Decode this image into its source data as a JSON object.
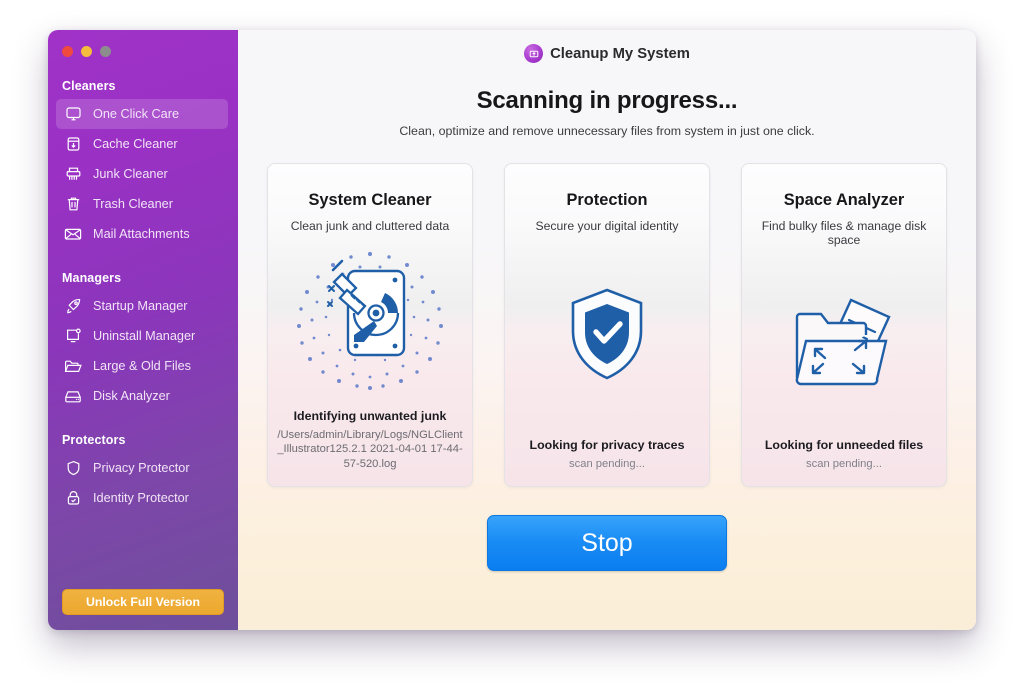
{
  "window": {
    "traffic_lights": [
      "close",
      "minimize",
      "zoom"
    ]
  },
  "sidebar": {
    "sections": [
      {
        "title": "Cleaners",
        "items": [
          {
            "label": "One Click Care",
            "icon": "monitor-icon",
            "active": true
          },
          {
            "label": "Cache Cleaner",
            "icon": "box-download-icon",
            "active": false
          },
          {
            "label": "Junk Cleaner",
            "icon": "shredder-icon",
            "active": false
          },
          {
            "label": "Trash Cleaner",
            "icon": "trash-icon",
            "active": false
          },
          {
            "label": "Mail Attachments",
            "icon": "envelope-icon",
            "active": false
          }
        ]
      },
      {
        "title": "Managers",
        "items": [
          {
            "label": "Startup Manager",
            "icon": "rocket-icon",
            "active": false
          },
          {
            "label": "Uninstall Manager",
            "icon": "monitor-gear-icon",
            "active": false
          },
          {
            "label": "Large & Old Files",
            "icon": "open-folder-icon",
            "active": false
          },
          {
            "label": "Disk Analyzer",
            "icon": "disk-drive-icon",
            "active": false
          }
        ]
      },
      {
        "title": "Protectors",
        "items": [
          {
            "label": "Privacy Protector",
            "icon": "shield-icon",
            "active": false
          },
          {
            "label": "Identity Protector",
            "icon": "lock-check-icon",
            "active": false
          }
        ]
      }
    ],
    "unlock_button": "Unlock Full Version"
  },
  "header": {
    "app_name": "Cleanup My System",
    "logo_icon": "cleanup-logo-icon",
    "headline": "Scanning in progress...",
    "subhead": "Clean, optimize and remove unnecessary files from system in just one click."
  },
  "cards": [
    {
      "title": "System Cleaner",
      "subtitle": "Clean junk and cluttered data",
      "art": "disk-broom-icon",
      "status": "Identifying unwanted junk",
      "detail": "/Users/admin/Library/Logs/NGLClient_Illustrator125.2.1 2021-04-01 17-44-57-520.log",
      "pending": false
    },
    {
      "title": "Protection",
      "subtitle": "Secure your digital identity",
      "art": "shield-check-icon",
      "status": "Looking for privacy traces",
      "detail": "scan pending...",
      "pending": true
    },
    {
      "title": "Space Analyzer",
      "subtitle": "Find bulky files & manage disk space",
      "art": "folder-expand-icon",
      "status": "Looking for unneeded files",
      "detail": "scan pending...",
      "pending": true
    }
  ],
  "action": {
    "stop_label": "Stop"
  },
  "colors": {
    "sidebar_purple": "#9a31c4",
    "accent_blue": "#1a8cf5",
    "unlock_orange": "#eca82f",
    "icon_blue": "#1f5fa8"
  }
}
